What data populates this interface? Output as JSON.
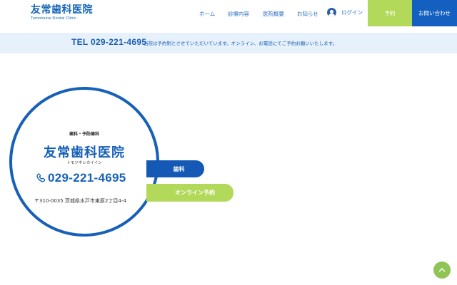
{
  "header": {
    "logo_main": "友常歯科医院",
    "logo_sub": "Tomotsune Dental Clinic",
    "nav": [
      {
        "label": "ホーム"
      },
      {
        "label": "診療内容"
      },
      {
        "label": "医院概要"
      },
      {
        "label": "お知らせ"
      }
    ],
    "login_label": "ログイン",
    "reserve_label": "予約",
    "contact_label": "お問い合わせ"
  },
  "infobar": {
    "tel": "TEL 029-221-4695",
    "text": "当院は予約制とさせていただいています。オンライン、お電話にてご予約お願いいたします。"
  },
  "clinic": {
    "category": "歯科・予防歯科",
    "name": "友常歯科医院",
    "kana": "トモツネシカイイン",
    "phone": "029-221-4695",
    "address": "〒310-0035 茨城県水戸市東原2丁目4-4"
  },
  "pills": {
    "dental": "歯科",
    "online": "オンライン予約"
  },
  "colors": {
    "brand_blue": "#1760b8",
    "accent_green": "#b2d95a",
    "infobar_bg": "#e6f1fb"
  }
}
